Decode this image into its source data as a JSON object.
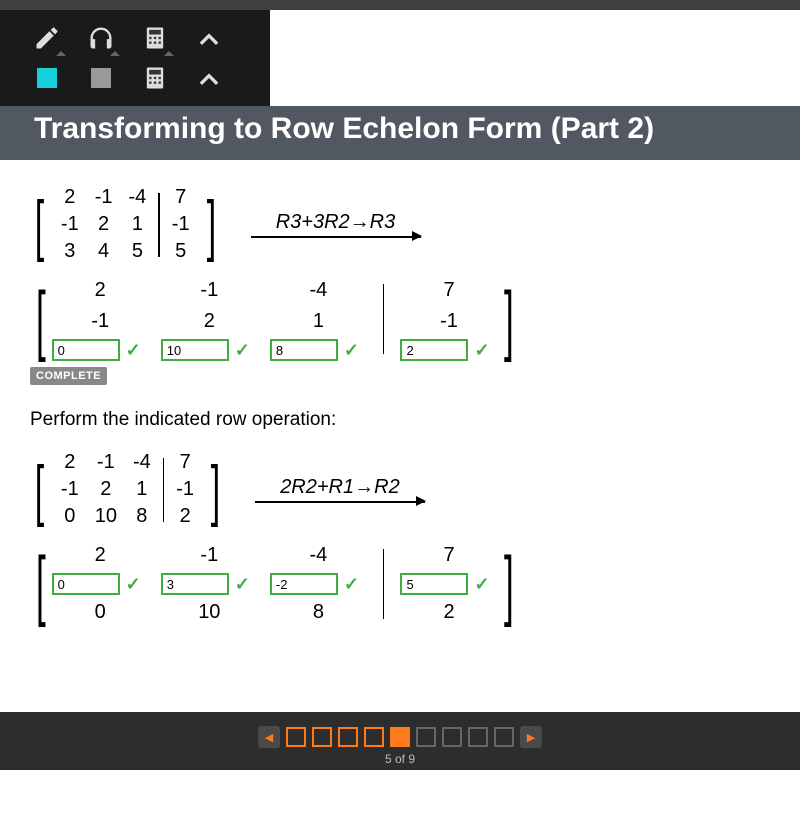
{
  "title": "Transforming to Row Echelon Form (Part 2)",
  "problem1": {
    "matrix": {
      "cols": [
        [
          "2",
          "-1",
          "3"
        ],
        [
          "-1",
          "2",
          "4"
        ],
        [
          "-4",
          "1",
          "5"
        ]
      ],
      "aug": [
        "7",
        "-1",
        "5"
      ]
    },
    "operation": "R3+3R2→R3",
    "result": {
      "cols": [
        [
          "2",
          "-1"
        ],
        [
          "-1",
          "2"
        ],
        [
          "-4",
          "1"
        ]
      ],
      "aug": [
        "7",
        "-1"
      ],
      "inputs": [
        "0",
        "10",
        "8",
        "2"
      ]
    },
    "complete_label": "COMPLETE"
  },
  "instruction": "Perform the indicated row operation:",
  "problem2": {
    "matrix": {
      "cols": [
        [
          "2",
          "-1",
          "0"
        ],
        [
          "-1",
          "2",
          "10"
        ],
        [
          "-4",
          "1",
          "8"
        ]
      ],
      "aug": [
        "7",
        "-1",
        "2"
      ]
    },
    "operation": "2R2+R1→R2",
    "result": {
      "col_top": [
        "2",
        "-1",
        "-4"
      ],
      "col_bot": [
        "0",
        "10",
        "8"
      ],
      "aug_top": "7",
      "aug_bot": "2",
      "inputs": [
        "0",
        "3",
        "-2",
        "5"
      ]
    }
  },
  "pager": {
    "current": 5,
    "total": 9,
    "label": "5 of 9"
  }
}
